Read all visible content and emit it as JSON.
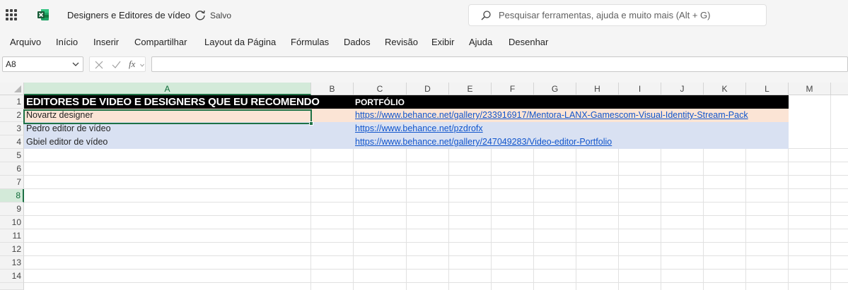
{
  "titlebar": {
    "doc_title": "Designers e Editores de vídeo",
    "save_status": "Salvo",
    "search_placeholder": "Pesquisar ferramentas, ajuda e muito mais (Alt + G)"
  },
  "menu": [
    "Arquivo",
    "Início",
    "Inserir",
    "Compartilhar",
    "Layout da Página",
    "Fórmulas",
    "Dados",
    "Revisão",
    "Exibir",
    "Ajuda",
    "Desenhar"
  ],
  "formula_bar": {
    "name_box": "A8",
    "fx_label": "fx",
    "formula": ""
  },
  "columns": [
    "A",
    "B",
    "C",
    "D",
    "E",
    "F",
    "G",
    "H",
    "I",
    "J",
    "K",
    "L",
    "M"
  ],
  "rows": [
    "1",
    "2",
    "3",
    "4",
    "5",
    "6",
    "7",
    "8",
    "9",
    "10",
    "11",
    "12",
    "13",
    "14"
  ],
  "selected": {
    "column": "A",
    "row": "8"
  },
  "sheet": {
    "header_a": "EDITORES DE VIDEO E DESIGNERS QUE EU RECOMENDO",
    "header_c": "PORTFÓLIO",
    "entries": [
      {
        "name": "Novartz designer",
        "url": "https://www.behance.net/gallery/233916917/Mentora-LANX-Gamescom-Visual-Identity-Stream-Pack"
      },
      {
        "name": "Pedro editor de vídeo",
        "url": "https://www.behance.net/pzdrofx"
      },
      {
        "name": "Gbiel editor de vídeo",
        "url": "https://www.behance.net/gallery/247049283/Video-editor-Portfolio"
      }
    ]
  },
  "colors": {
    "header_fill": "#000000",
    "row2_fill": "#fbe4d5",
    "row34_fill": "#d9e1f2",
    "accent": "#1e7145",
    "link": "#1155cc"
  },
  "icons": [
    "app-launcher-icon",
    "excel-logo-icon",
    "sync-icon",
    "search-icon",
    "chevron-down-icon",
    "cancel-icon",
    "check-icon"
  ]
}
